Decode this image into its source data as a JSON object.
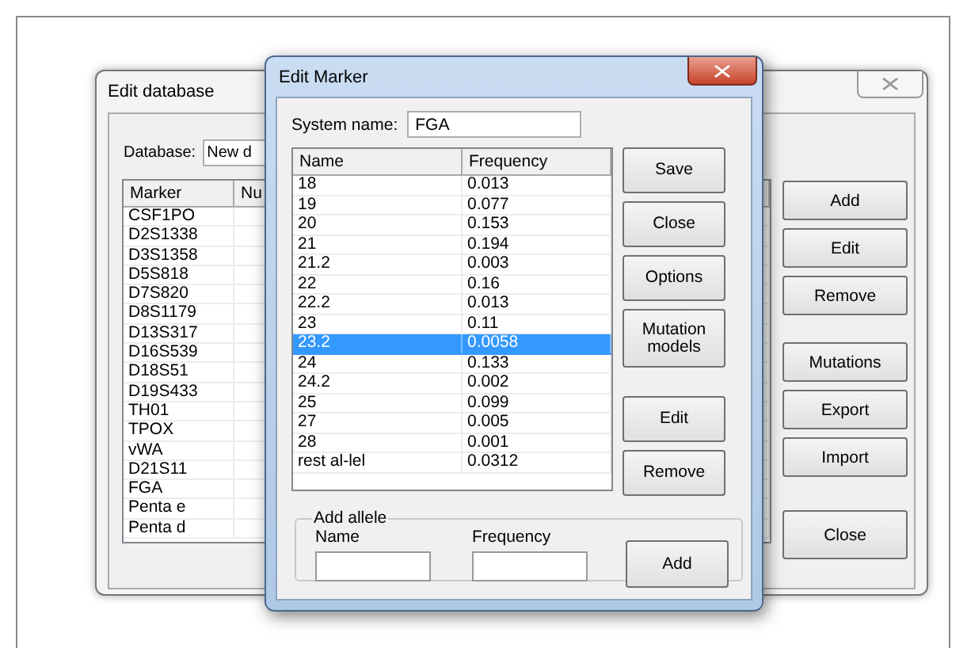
{
  "background_window": {
    "title": "Edit database",
    "database_label": "Database:",
    "database_value": "New d",
    "columns": [
      "Marker",
      "Nu"
    ],
    "markers": [
      "CSF1PO",
      "D2S1338",
      "D3S1358",
      "D5S818",
      "D7S820",
      "D8S1179",
      "D13S317",
      "D16S539",
      "D18S51",
      "D19S433",
      "TH01",
      "TPOX",
      "vWA",
      "D21S11",
      "FGA",
      "Penta e",
      "Penta d"
    ],
    "button_groups": [
      [
        "Add",
        "Edit",
        "Remove"
      ],
      [
        "Mutations",
        "Export",
        "Import"
      ],
      [
        "Close"
      ]
    ]
  },
  "dialog": {
    "title": "Edit Marker",
    "system_name_label": "System name:",
    "system_name": "FGA",
    "columns": [
      "Name",
      "Frequency"
    ],
    "alleles": [
      {
        "name": "18",
        "frequency": "0.013",
        "selected": false
      },
      {
        "name": "19",
        "frequency": "0.077",
        "selected": false
      },
      {
        "name": "20",
        "frequency": "0.153",
        "selected": false
      },
      {
        "name": "21",
        "frequency": "0.194",
        "selected": false
      },
      {
        "name": "21.2",
        "frequency": "0.003",
        "selected": false
      },
      {
        "name": "22",
        "frequency": "0.16",
        "selected": false
      },
      {
        "name": "22.2",
        "frequency": "0.013",
        "selected": false
      },
      {
        "name": "23",
        "frequency": "0.11",
        "selected": false
      },
      {
        "name": "23.2",
        "frequency": "0.0058",
        "selected": true
      },
      {
        "name": "24",
        "frequency": "0.133",
        "selected": false
      },
      {
        "name": "24.2",
        "frequency": "0.002",
        "selected": false
      },
      {
        "name": "25",
        "frequency": "0.099",
        "selected": false
      },
      {
        "name": "27",
        "frequency": "0.005",
        "selected": false
      },
      {
        "name": "28",
        "frequency": "0.001",
        "selected": false
      },
      {
        "name": "rest al-lel",
        "frequency": "0.0312",
        "selected": false
      }
    ],
    "button_groups": [
      [
        "Save",
        "Close",
        "Options",
        "Mutation models"
      ],
      [
        "Edit",
        "Remove"
      ]
    ],
    "add_allele": {
      "title": "Add allele",
      "name_label": "Name",
      "frequency_label": "Frequency",
      "button": "Add"
    }
  }
}
